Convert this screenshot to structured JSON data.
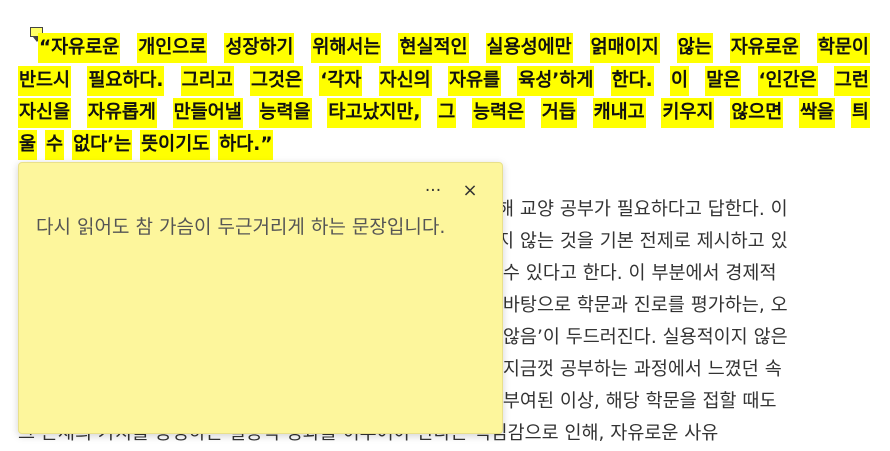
{
  "highlighted_quote": {
    "line1": [
      "“자유로운",
      "개인으로",
      "성장하기",
      "위해서는",
      "현실적인",
      "실용성에만",
      "얽매이지",
      "않는",
      "자유로운",
      "학문이"
    ],
    "line2": [
      "반드시",
      "필요하다.",
      "그리고",
      "그것은",
      "‘각자",
      "자신의",
      "자유를",
      "육성’하게",
      "한다.",
      "이",
      "말은",
      "‘인간은",
      "그런"
    ],
    "line3": [
      "자신을",
      "자유롭게",
      "만들어낼",
      "능력을",
      "타고났지만,",
      "그",
      "능력은",
      "거듭",
      "캐내고",
      "키우지",
      "않으면",
      "싹을",
      "틔"
    ],
    "line4": [
      "울",
      "수",
      "없다’는",
      "뜻이기도",
      "하다.”"
    ]
  },
  "body_text": {
    "line5": "위해 교양 공부가 필요하다고 답한다. 이",
    "line6": "이지 않는 것을 기본 전제로 제시하고 있",
    "line7": "킬 수 있다고 한다. 이 부분에서 경제적",
    "line8": "을 바탕으로 학문과 진로를 평가하는, 오",
    "line9": "지 않음’이 두드러진다. 실용적이지 않은",
    "line10": "선 지금껏 공부하는 과정에서 느꼈던 속",
    "line11": "가 부여된 이상, 해당 학문을 접할 때도",
    "line12": "그 존재의 가치를 증명하는 실용적 성과를 이루어야 한다는 책임감으로 인해, 자유로운 사유"
  },
  "sticky_note": {
    "text": "다시 읽어도 참 가슴이 두근거리게 하는 문장입니다.",
    "more_label": "···",
    "close_label": "×"
  },
  "colors": {
    "highlight": "#ffff00",
    "sticky_bg": "#fdf69c"
  }
}
